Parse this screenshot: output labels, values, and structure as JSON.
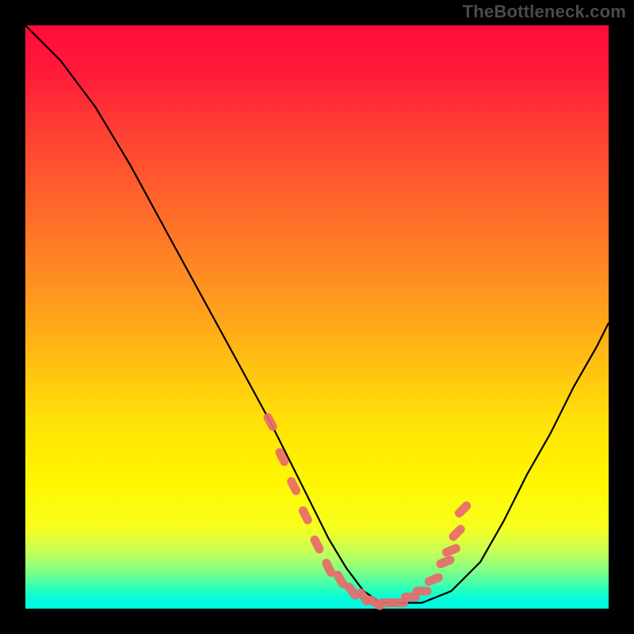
{
  "watermark": "TheBottleneck.com",
  "colors": {
    "frame": "#000000",
    "curve": "#000000",
    "marker": "#e86a6a",
    "gradient_top": "#ff0a3c",
    "gradient_bottom": "#02fae0"
  },
  "chart_data": {
    "type": "line",
    "title": "",
    "xlabel": "",
    "ylabel": "",
    "xlim": [
      0,
      100
    ],
    "ylim": [
      0,
      100
    ],
    "grid": false,
    "series": [
      {
        "name": "curve",
        "x": [
          0,
          6,
          12,
          18,
          24,
          30,
          36,
          42,
          48,
          52,
          55,
          58,
          61,
          64,
          68,
          73,
          78,
          82,
          86,
          90,
          94,
          98,
          100
        ],
        "y": [
          100,
          94,
          86,
          76,
          65,
          54,
          43,
          32,
          20,
          12,
          7,
          3,
          1,
          1,
          1,
          3,
          8,
          15,
          23,
          30,
          38,
          45,
          49
        ]
      }
    ],
    "markers": {
      "name": "highlighted-segment",
      "comment": "salmon capsule markers near the valley, left descending arm and right ascending arm",
      "x": [
        42,
        44,
        46,
        48,
        50,
        52,
        54,
        56,
        58,
        60,
        62,
        64,
        66,
        68,
        70,
        72,
        73,
        74,
        75
      ],
      "y": [
        32,
        26,
        21,
        16,
        11,
        7,
        5,
        3,
        2,
        1,
        1,
        1,
        2,
        3,
        5,
        8,
        10,
        13,
        17
      ]
    }
  }
}
